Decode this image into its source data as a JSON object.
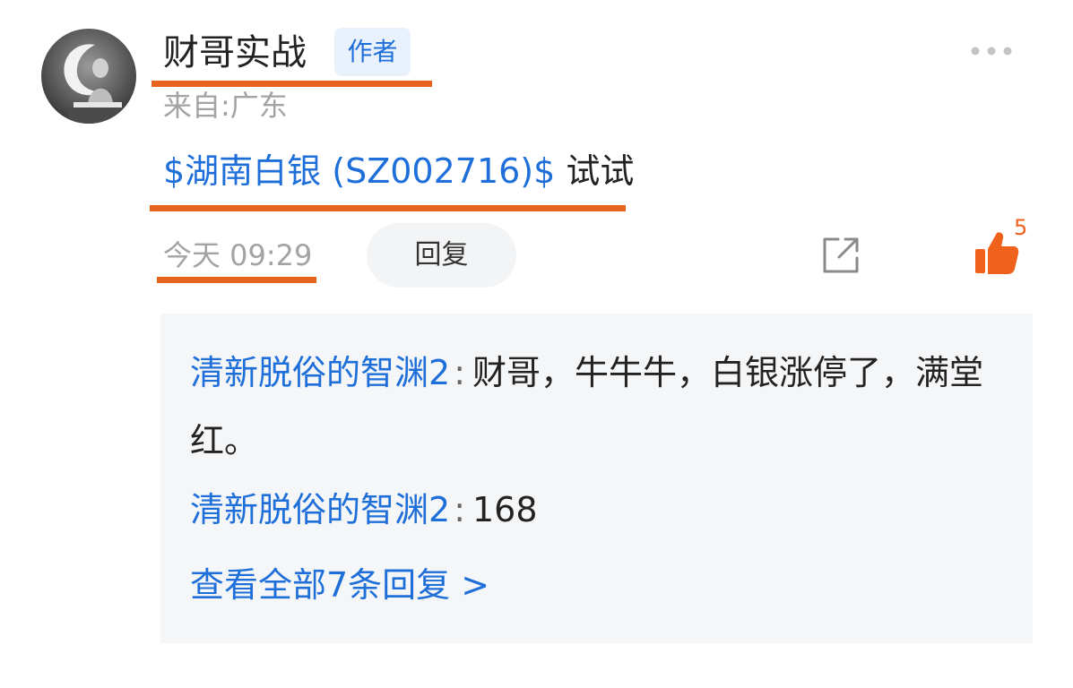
{
  "author": {
    "name": "财哥实战",
    "badge": "作者",
    "location": "来自:广东",
    "avatar_icon": "buddha-statue-avatar"
  },
  "post": {
    "stock_link": "$湖南白银 (SZ002716)$",
    "text": " 试试",
    "time": "今天 09:29",
    "reply_label": "回复",
    "like_count": "5"
  },
  "icons": {
    "more": "more-dots-icon",
    "share": "share-icon",
    "like": "thumbs-up-icon"
  },
  "replies": [
    {
      "user": "清新脱俗的智渊2",
      "colon": ":",
      "text": "财哥，牛牛牛，白银涨停了，满堂红。"
    },
    {
      "user": "清新脱俗的智渊2",
      "colon": ":",
      "text": "168"
    }
  ],
  "view_all": "查看全部7条回复 >",
  "colors": {
    "link_blue": "#1e6fd9",
    "like_orange": "#f0611b",
    "underline_orange": "#e8631c",
    "reply_bg": "#f5f6f8"
  }
}
